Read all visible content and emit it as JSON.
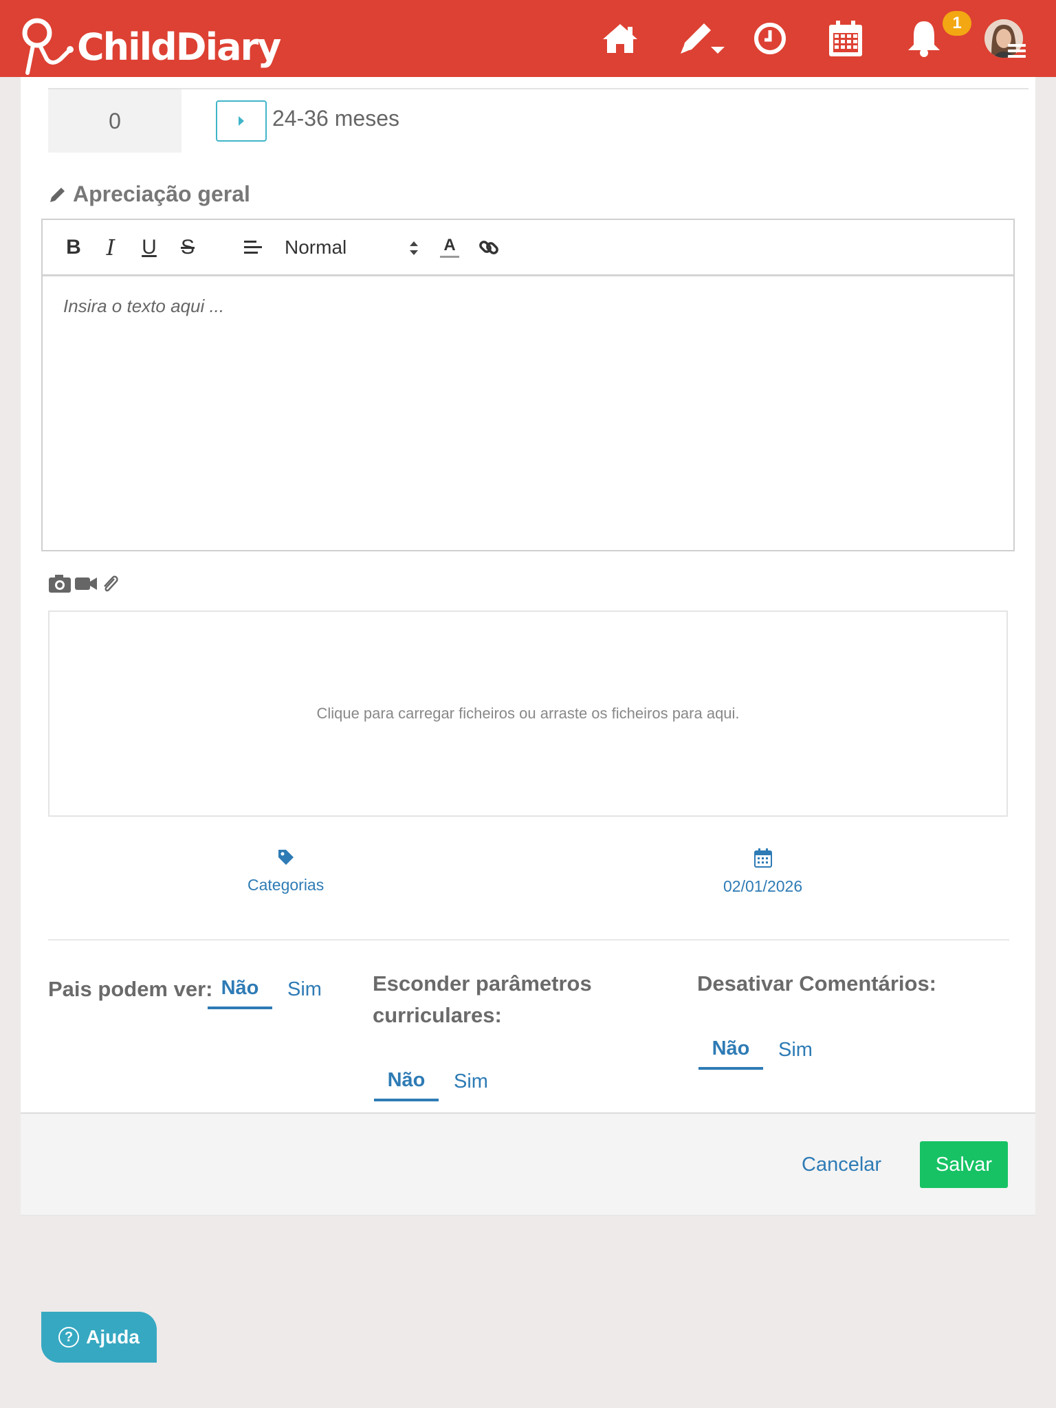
{
  "app": {
    "brand": "ChildDiary",
    "notification_count": "1"
  },
  "nav": {
    "icons": [
      "home-icon",
      "pencil-icon",
      "clock-icon",
      "calendar-icon",
      "bell-icon"
    ]
  },
  "row": {
    "score": "0",
    "age_range": "24-36 meses"
  },
  "section": {
    "title": "Apreciação geral"
  },
  "editor": {
    "toolbar": {
      "bold": "B",
      "italic": "I",
      "underline": "U",
      "strike": "S",
      "format": "Normal",
      "color": "A"
    },
    "placeholder": "Insira o texto aqui ..."
  },
  "upload": {
    "hint": "Clique para carregar ficheiros ou arraste os ficheiros para aqui."
  },
  "meta": {
    "categories": "Categorias",
    "date": "02/01/2026"
  },
  "options": {
    "parents": {
      "label": "Pais podem ver:",
      "no": "Não",
      "yes": "Sim",
      "selected": "Não"
    },
    "hide_params": {
      "label_line1": "Esconder parâmetros",
      "label_line2": "curriculares:",
      "no": "Não",
      "yes": "Sim",
      "selected": "Não"
    },
    "disable_comments": {
      "label": "Desativar Comentários:",
      "no": "Não",
      "yes": "Sim",
      "selected": "Não"
    }
  },
  "actions": {
    "cancel": "Cancelar",
    "save": "Salvar"
  },
  "help": {
    "label": "Ajuda",
    "icon": "?"
  },
  "colors": {
    "header": "#dd4133",
    "accent": "#2e7bb5",
    "save": "#17c264",
    "help": "#36a8c2",
    "badge": "#f3a712"
  }
}
